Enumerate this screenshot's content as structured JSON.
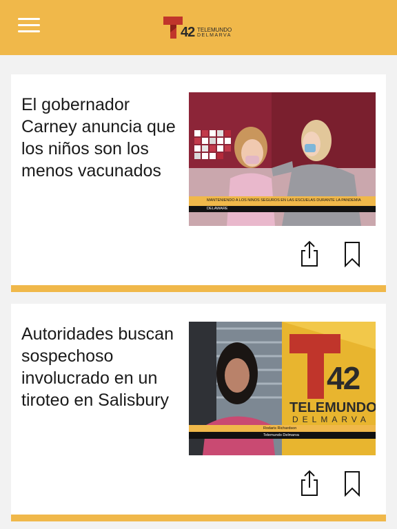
{
  "header": {
    "menu_icon": "hamburger-menu-icon",
    "logo": {
      "number": "42",
      "name": "TELEMUNDO",
      "subname": "DELMARVA",
      "accent_color": "#c0352b"
    },
    "background_color": "#f0b84a"
  },
  "articles": [
    {
      "headline": "El gobernador Carney anuncia que los niños son los menos vacunados en",
      "image": {
        "lower_third_main": "MANTENIENDO A LOS NIÑOS SEGUROS EN LAS ESCUELAS DURANTE LA PANDEMIA",
        "lower_third_sub": "DELAWARE"
      },
      "share_icon": "share-icon",
      "bookmark_icon": "bookmark-icon"
    },
    {
      "headline": "Autoridades buscan sospechoso involucrado en un tiroteo en Salisbury",
      "image": {
        "logo_number": "42",
        "logo_name": "TELEMUNDO",
        "logo_subname": "DELMARVA",
        "lower_third_name": "Rodaris Richardson",
        "lower_third_org": "Telemundo Delmarva"
      },
      "share_icon": "share-icon",
      "bookmark_icon": "bookmark-icon"
    }
  ]
}
